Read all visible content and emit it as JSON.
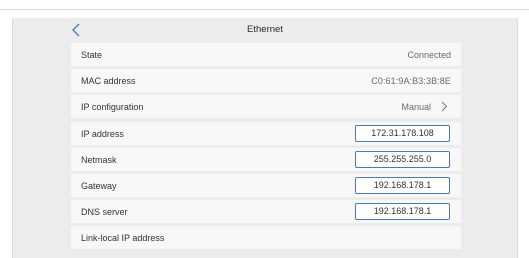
{
  "header": {
    "title": "Ethernet"
  },
  "colors": {
    "accent": "#4a79b5",
    "panel_bg": "#ececec",
    "row_bg": "#f8f8f8"
  },
  "rows": [
    {
      "label": "State",
      "value": "Connected"
    },
    {
      "label": "MAC address",
      "value": "C0:61:9A:B3:3B:8E"
    },
    {
      "label": "IP configuration",
      "value": "Manual"
    },
    {
      "label": "IP address",
      "value": "172.31.178.108"
    },
    {
      "label": "Netmask",
      "value": "255.255.255.0"
    },
    {
      "label": "Gateway",
      "value": "192.168.178.1"
    },
    {
      "label": "DNS server",
      "value": "192.168.178.1"
    },
    {
      "label": "Link-local IP address"
    }
  ],
  "icons": {
    "back": "chevron-left-icon",
    "ip_config": "chevron-right-icon"
  }
}
